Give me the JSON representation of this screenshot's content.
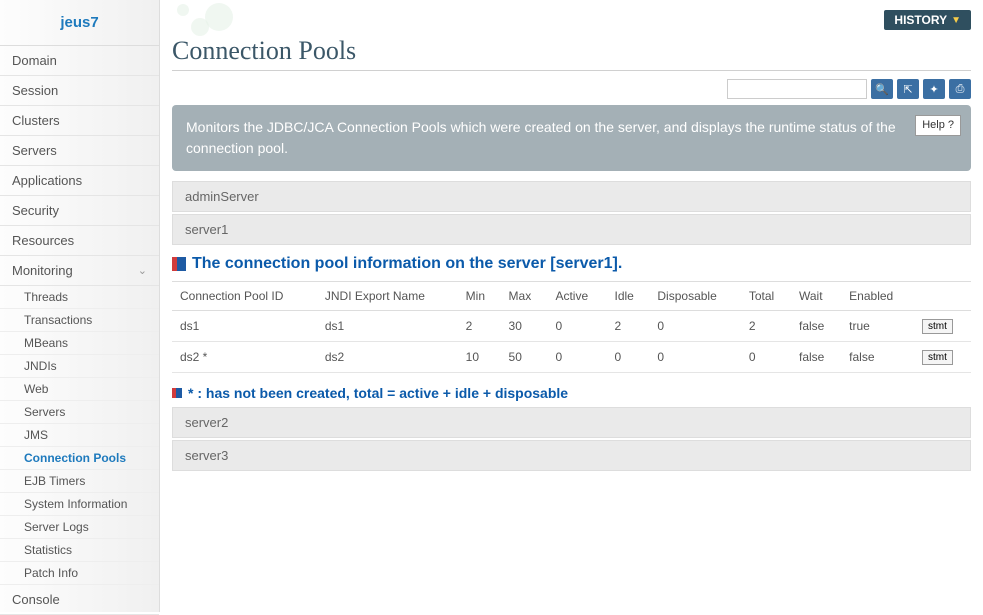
{
  "sidebar": {
    "logo": "jeus7",
    "items": [
      "Domain",
      "Session",
      "Clusters",
      "Servers",
      "Applications",
      "Security",
      "Resources",
      "Monitoring"
    ],
    "sub": [
      "Threads",
      "Transactions",
      "MBeans",
      "JNDIs",
      "Web",
      "Servers",
      "JMS",
      "Connection Pools",
      "EJB Timers",
      "System Information",
      "Server Logs",
      "Statistics",
      "Patch Info"
    ],
    "console": "Console"
  },
  "topbar": {
    "history": "HISTORY"
  },
  "page": {
    "title": "Connection Pools",
    "search_placeholder": "",
    "desc": "Monitors the JDBC/JCA Connection Pools which were created on the server, and displays the runtime status of the connection pool.",
    "help": "Help  ?"
  },
  "servers_top": [
    "adminServer",
    "server1"
  ],
  "section_title": "The connection pool information on the server [server1].",
  "table": {
    "headers": [
      "Connection Pool ID",
      "JNDI Export Name",
      "Min",
      "Max",
      "Active",
      "Idle",
      "Disposable",
      "Total",
      "Wait",
      "Enabled",
      ""
    ],
    "rows": [
      {
        "id": "ds1",
        "jndi": "ds1",
        "min": "2",
        "max": "30",
        "active": "0",
        "idle": "2",
        "disposable": "0",
        "total": "2",
        "wait": "false",
        "enabled": "true",
        "btn": "stmt"
      },
      {
        "id": "ds2 *",
        "jndi": "ds2",
        "min": "10",
        "max": "50",
        "active": "0",
        "idle": "0",
        "disposable": "0",
        "total": "0",
        "wait": "false",
        "enabled": "false",
        "btn": "stmt"
      }
    ]
  },
  "legend": "* : has not been created, total = active + idle + disposable",
  "servers_bottom": [
    "server2",
    "server3"
  ]
}
